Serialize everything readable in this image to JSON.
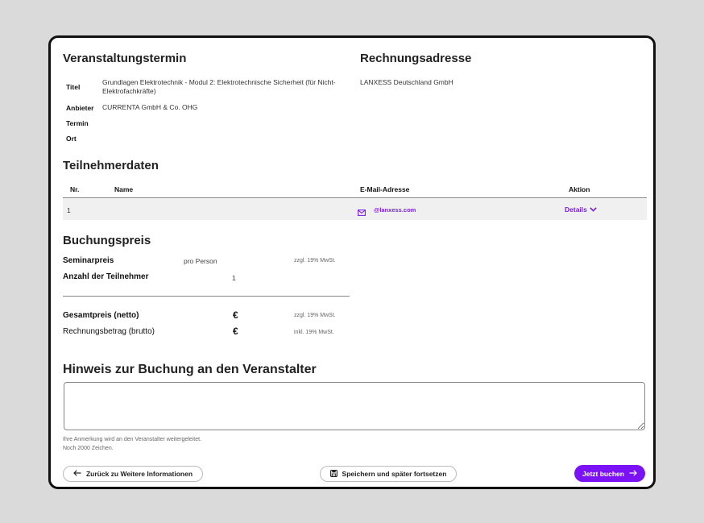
{
  "event": {
    "heading": "Veranstaltungstermin",
    "rows": [
      {
        "label": "Titel",
        "value": "Grundlagen Elektrotechnik - Modul 2: Elektrotechnische Sicherheit (für Nicht-Elektrofachkräfte)"
      },
      {
        "label": "Anbieter",
        "value": "CURRENTA GmbH & Co. OHG"
      },
      {
        "label": "Termin",
        "value": ""
      },
      {
        "label": "Ort",
        "value": ""
      }
    ]
  },
  "billing": {
    "heading": "Rechnungsadresse",
    "company": "LANXESS Deutschland GmbH"
  },
  "participants": {
    "heading": "Teilnehmerdaten",
    "columns": [
      "Nr.",
      "Name",
      "E-Mail-Adresse",
      "Aktion"
    ],
    "rows": [
      {
        "nr": "1",
        "name": "",
        "email": "@lanxess.com",
        "action": "Details"
      }
    ]
  },
  "price": {
    "heading": "Buchungspreis",
    "seminar_label": "Seminarpreis",
    "seminar_unit": "pro Person",
    "seminar_tax": "zzgl. 19% MwSt.",
    "count_label": "Anzahl der Teilnehmer",
    "count_value": "1",
    "net_label": "Gesamtpreis (netto)",
    "net_currency": "€",
    "net_tax": "zzgl. 19% MwSt.",
    "gross_label": "Rechnungsbetrag (brutto)",
    "gross_currency": "€",
    "gross_tax": "inkl. 19% MwSt."
  },
  "note": {
    "heading": "Hinweis zur Buchung an den Veranstalter",
    "value": "",
    "hint_line1": "Ihre Anmerkung wird an den Veranstalter weitergeleitet.",
    "hint_line2": "Noch 2000 Zeichen."
  },
  "footer": {
    "back_label": "Zurück zu Weitere Informationen",
    "save_label": "Speichern und später fortsetzen",
    "book_label": "Jetzt buchen"
  },
  "colors": {
    "accent": "#7a12f5",
    "link": "#7a1fe0",
    "row_bg": "#f0f0f0"
  }
}
